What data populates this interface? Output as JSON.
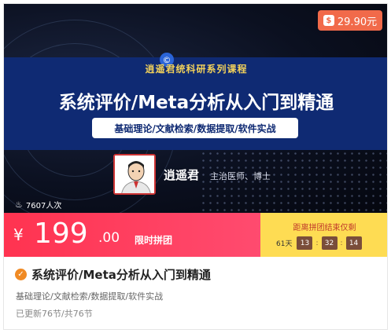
{
  "badge": {
    "price": "29.90元",
    "icon": "money-bag-icon"
  },
  "banner": {
    "series_title": "逍遥君统科研系列课程",
    "main_title": "系统评价/Meta分析从入门到精通",
    "subtitle": "基础理论/文献检索/数据提取/软件实战",
    "author_name": "逍遥君",
    "author_title": "主治医师、博士",
    "views": "7607人次"
  },
  "promo": {
    "currency": "¥",
    "price_int": "199",
    "price_dec": ".00",
    "label": "限时拼团",
    "countdown_label": "距离拼团结束仅剩",
    "days": "61天",
    "hours": "13",
    "minutes": "32",
    "seconds": "14"
  },
  "course": {
    "title": "系统评价/Meta分析从入门到精通",
    "desc": "基础理论/文献检索/数据提取/软件实战",
    "progress": "已更新76节/共76节"
  },
  "colors": {
    "promo_red": "#ff3d58",
    "promo_yellow": "#fedc53",
    "navy": "#0f2a73",
    "accent_orange": "#f16a4a"
  }
}
